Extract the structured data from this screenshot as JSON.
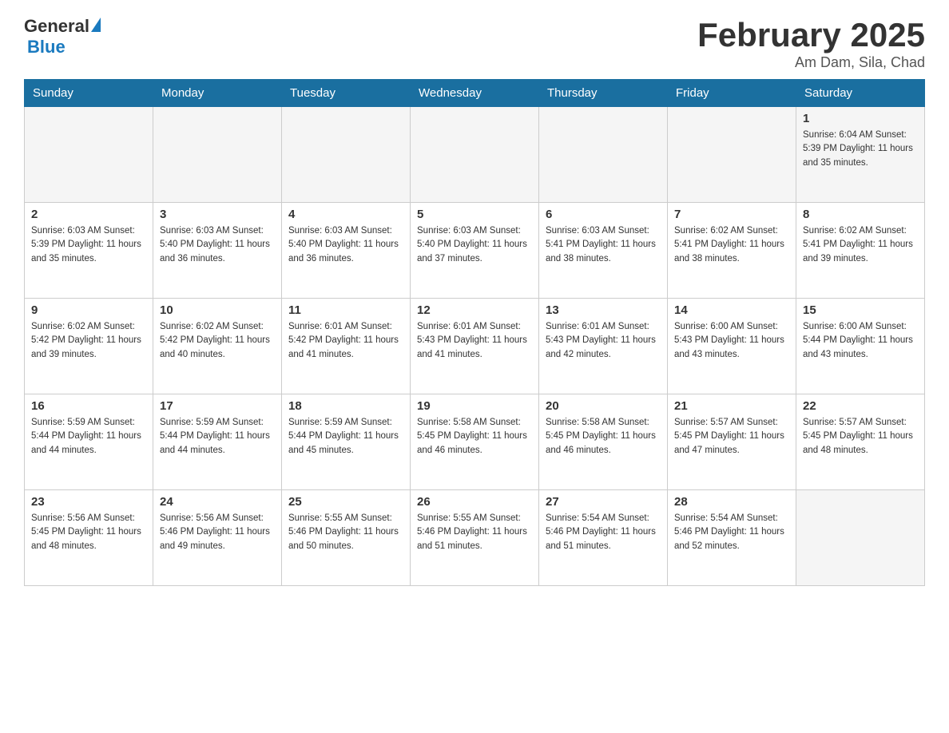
{
  "header": {
    "logo_general": "General",
    "logo_blue": "Blue",
    "title": "February 2025",
    "subtitle": "Am Dam, Sila, Chad"
  },
  "days_of_week": [
    "Sunday",
    "Monday",
    "Tuesday",
    "Wednesday",
    "Thursday",
    "Friday",
    "Saturday"
  ],
  "weeks": [
    [
      {
        "day": "",
        "info": ""
      },
      {
        "day": "",
        "info": ""
      },
      {
        "day": "",
        "info": ""
      },
      {
        "day": "",
        "info": ""
      },
      {
        "day": "",
        "info": ""
      },
      {
        "day": "",
        "info": ""
      },
      {
        "day": "1",
        "info": "Sunrise: 6:04 AM\nSunset: 5:39 PM\nDaylight: 11 hours and 35 minutes."
      }
    ],
    [
      {
        "day": "2",
        "info": "Sunrise: 6:03 AM\nSunset: 5:39 PM\nDaylight: 11 hours and 35 minutes."
      },
      {
        "day": "3",
        "info": "Sunrise: 6:03 AM\nSunset: 5:40 PM\nDaylight: 11 hours and 36 minutes."
      },
      {
        "day": "4",
        "info": "Sunrise: 6:03 AM\nSunset: 5:40 PM\nDaylight: 11 hours and 36 minutes."
      },
      {
        "day": "5",
        "info": "Sunrise: 6:03 AM\nSunset: 5:40 PM\nDaylight: 11 hours and 37 minutes."
      },
      {
        "day": "6",
        "info": "Sunrise: 6:03 AM\nSunset: 5:41 PM\nDaylight: 11 hours and 38 minutes."
      },
      {
        "day": "7",
        "info": "Sunrise: 6:02 AM\nSunset: 5:41 PM\nDaylight: 11 hours and 38 minutes."
      },
      {
        "day": "8",
        "info": "Sunrise: 6:02 AM\nSunset: 5:41 PM\nDaylight: 11 hours and 39 minutes."
      }
    ],
    [
      {
        "day": "9",
        "info": "Sunrise: 6:02 AM\nSunset: 5:42 PM\nDaylight: 11 hours and 39 minutes."
      },
      {
        "day": "10",
        "info": "Sunrise: 6:02 AM\nSunset: 5:42 PM\nDaylight: 11 hours and 40 minutes."
      },
      {
        "day": "11",
        "info": "Sunrise: 6:01 AM\nSunset: 5:42 PM\nDaylight: 11 hours and 41 minutes."
      },
      {
        "day": "12",
        "info": "Sunrise: 6:01 AM\nSunset: 5:43 PM\nDaylight: 11 hours and 41 minutes."
      },
      {
        "day": "13",
        "info": "Sunrise: 6:01 AM\nSunset: 5:43 PM\nDaylight: 11 hours and 42 minutes."
      },
      {
        "day": "14",
        "info": "Sunrise: 6:00 AM\nSunset: 5:43 PM\nDaylight: 11 hours and 43 minutes."
      },
      {
        "day": "15",
        "info": "Sunrise: 6:00 AM\nSunset: 5:44 PM\nDaylight: 11 hours and 43 minutes."
      }
    ],
    [
      {
        "day": "16",
        "info": "Sunrise: 5:59 AM\nSunset: 5:44 PM\nDaylight: 11 hours and 44 minutes."
      },
      {
        "day": "17",
        "info": "Sunrise: 5:59 AM\nSunset: 5:44 PM\nDaylight: 11 hours and 44 minutes."
      },
      {
        "day": "18",
        "info": "Sunrise: 5:59 AM\nSunset: 5:44 PM\nDaylight: 11 hours and 45 minutes."
      },
      {
        "day": "19",
        "info": "Sunrise: 5:58 AM\nSunset: 5:45 PM\nDaylight: 11 hours and 46 minutes."
      },
      {
        "day": "20",
        "info": "Sunrise: 5:58 AM\nSunset: 5:45 PM\nDaylight: 11 hours and 46 minutes."
      },
      {
        "day": "21",
        "info": "Sunrise: 5:57 AM\nSunset: 5:45 PM\nDaylight: 11 hours and 47 minutes."
      },
      {
        "day": "22",
        "info": "Sunrise: 5:57 AM\nSunset: 5:45 PM\nDaylight: 11 hours and 48 minutes."
      }
    ],
    [
      {
        "day": "23",
        "info": "Sunrise: 5:56 AM\nSunset: 5:45 PM\nDaylight: 11 hours and 48 minutes."
      },
      {
        "day": "24",
        "info": "Sunrise: 5:56 AM\nSunset: 5:46 PM\nDaylight: 11 hours and 49 minutes."
      },
      {
        "day": "25",
        "info": "Sunrise: 5:55 AM\nSunset: 5:46 PM\nDaylight: 11 hours and 50 minutes."
      },
      {
        "day": "26",
        "info": "Sunrise: 5:55 AM\nSunset: 5:46 PM\nDaylight: 11 hours and 51 minutes."
      },
      {
        "day": "27",
        "info": "Sunrise: 5:54 AM\nSunset: 5:46 PM\nDaylight: 11 hours and 51 minutes."
      },
      {
        "day": "28",
        "info": "Sunrise: 5:54 AM\nSunset: 5:46 PM\nDaylight: 11 hours and 52 minutes."
      },
      {
        "day": "",
        "info": ""
      }
    ]
  ]
}
